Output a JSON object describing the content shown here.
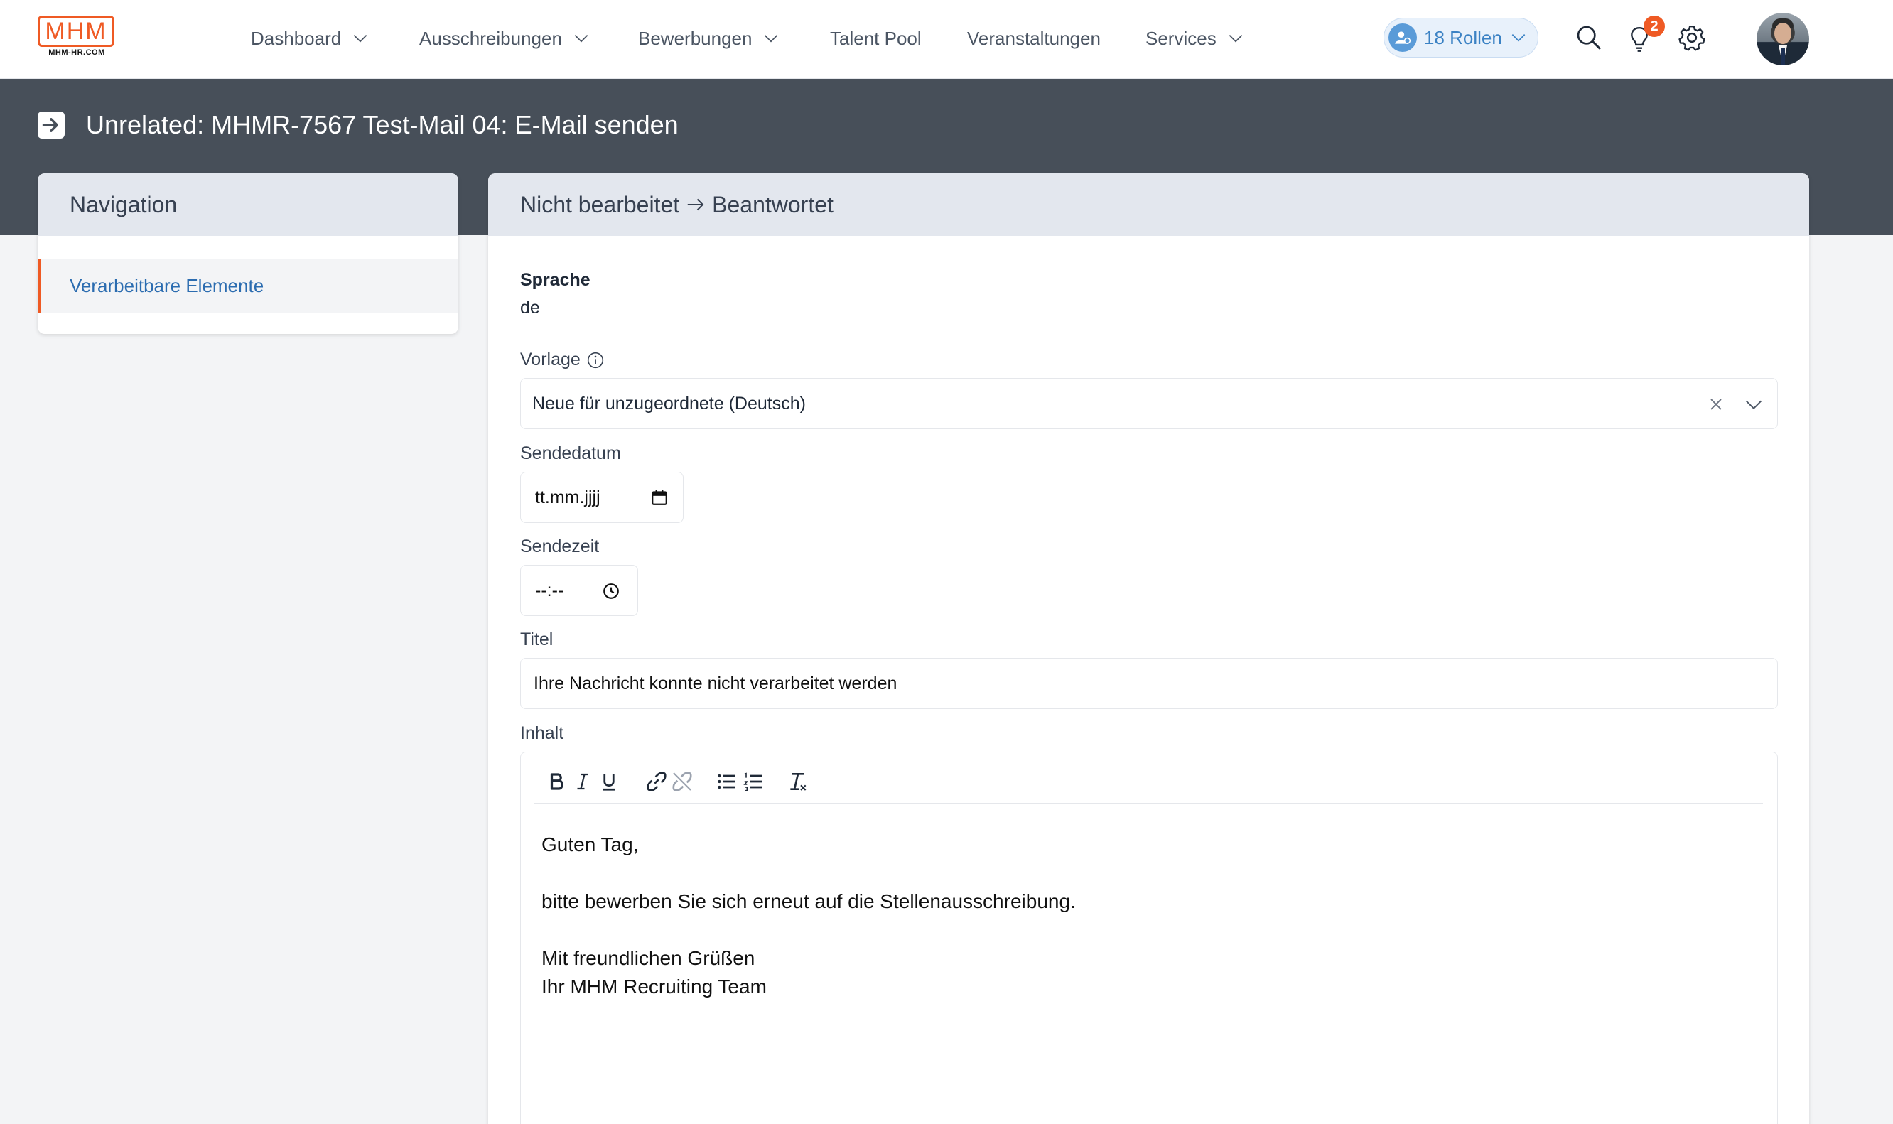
{
  "logo": {
    "mark": "MHM",
    "sub": "MHM-HR.COM",
    "color": "#ef5a24"
  },
  "nav": {
    "items": [
      {
        "label": "Dashboard",
        "has_dropdown": true
      },
      {
        "label": "Ausschreibungen",
        "has_dropdown": true
      },
      {
        "label": "Bewerbungen",
        "has_dropdown": true
      },
      {
        "label": "Talent Pool",
        "has_dropdown": false
      },
      {
        "label": "Veranstaltungen",
        "has_dropdown": false
      },
      {
        "label": "Services",
        "has_dropdown": true
      }
    ]
  },
  "header": {
    "roles_label": "18 Rollen",
    "notification_count": "2",
    "icons": [
      "user-gear-icon",
      "search-icon",
      "lightbulb-icon",
      "gear-icon",
      "avatar"
    ]
  },
  "page": {
    "title": "Unrelated: MHMR-7567 Test-Mail 04: E-Mail senden"
  },
  "sidebar": {
    "title": "Navigation",
    "items": [
      {
        "label": "Verarbeitbare Elemente",
        "active": true
      }
    ],
    "accent": "#ef5a24"
  },
  "main": {
    "status_from": "Nicht bearbeitet",
    "status_to": "Beantwortet",
    "language_label": "Sprache",
    "language_value": "de",
    "template_label": "Vorlage",
    "template_value": "Neue für unzugeordnete (Deutsch)",
    "send_date_label": "Sendedatum",
    "send_date_value": "tt.mm.jjjj",
    "send_time_label": "Sendezeit",
    "send_time_value": "--:--",
    "title_label": "Titel",
    "title_value": "Ihre Nachricht konnte nicht verarbeitet werden",
    "content_label": "Inhalt",
    "toolbar": [
      "bold",
      "italic",
      "underline",
      "link",
      "unlink",
      "bullet-list",
      "numbered-list",
      "clear-format"
    ],
    "content_lines": [
      "Guten Tag,",
      "",
      "bitte bewerben Sie sich erneut auf die Stellenausschreibung.",
      "",
      "Mit freundlichen Grüßen",
      "Ihr MHM Recruiting Team"
    ]
  }
}
